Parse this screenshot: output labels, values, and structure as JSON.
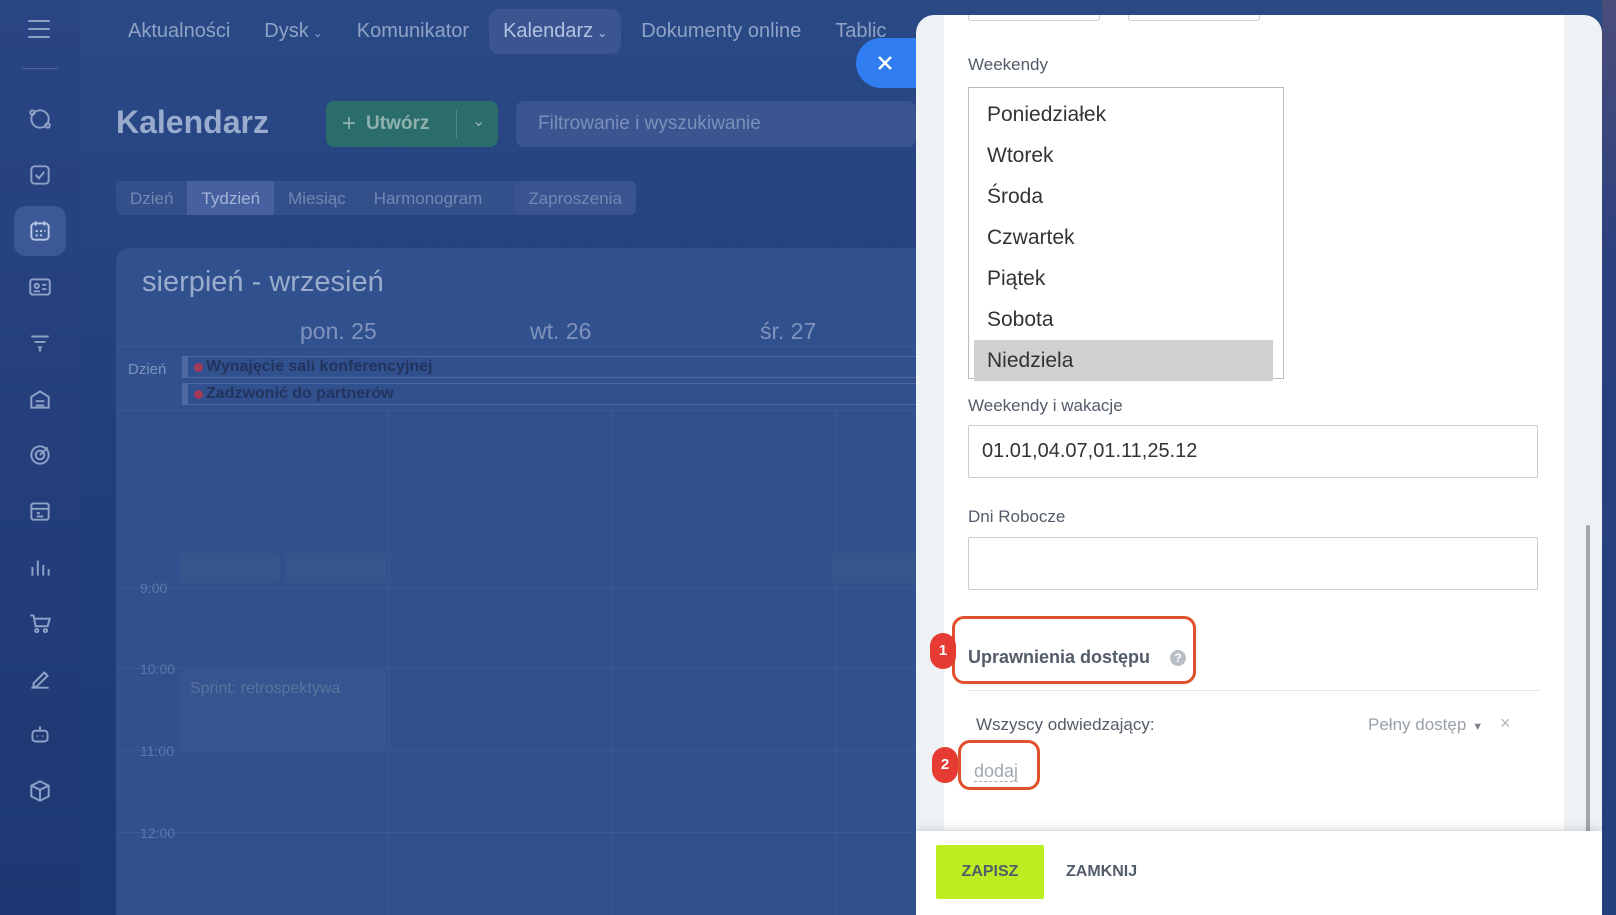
{
  "topnav": {
    "items": [
      {
        "label": "Aktualności",
        "has_menu": false,
        "active": false
      },
      {
        "label": "Dysk",
        "has_menu": true,
        "active": false
      },
      {
        "label": "Komunikator",
        "has_menu": false,
        "active": false
      },
      {
        "label": "Kalendarz",
        "has_menu": true,
        "active": true
      },
      {
        "label": "Dokumenty online",
        "has_menu": false,
        "active": false
      },
      {
        "label": "Tablic",
        "has_menu": false,
        "active": false
      }
    ]
  },
  "sidebar": {
    "icons": [
      "feed-icon",
      "tasks-icon",
      "calendar-icon",
      "contacts-icon",
      "filter-icon",
      "storage-icon",
      "target-icon",
      "schedule-icon",
      "chart-icon",
      "cart-icon",
      "sign-icon",
      "robot-icon",
      "cube-icon"
    ]
  },
  "page": {
    "title": "Kalendarz",
    "create_label": "Utwórz",
    "search_placeholder": "Filtrowanie i wyszukiwanie",
    "view_tabs": [
      "Dzień",
      "Tydzień",
      "Miesiąc",
      "Harmonogram"
    ],
    "invitations_tab": "Zaproszenia",
    "range_title": "sierpień - wrzesień",
    "day_headers": [
      "pon. 25",
      "wt. 26",
      "śr. 27"
    ],
    "allday_label": "Dzień",
    "allday_events": [
      "Wynajęcie sali konferencyjnej",
      "Zadzwonić do partnerów"
    ],
    "hours": [
      "9:00",
      "10:00",
      "11:00",
      "12:00"
    ],
    "sprint_event": "Sprint: retrospektywa"
  },
  "settings": {
    "weekends_label": "Weekendy",
    "weekdays": [
      "Poniedziałek",
      "Wtorek",
      "Środa",
      "Czwartek",
      "Piątek",
      "Sobota",
      "Niedziela"
    ],
    "weekend_selected": "Niedziela",
    "holidays_label": "Weekendy i wakacje",
    "holidays_value": "01.01,04.07,01.11,25.12",
    "workdays_label": "Dni Robocze",
    "workdays_value": "",
    "permissions_title": "Uprawnienia dostępu",
    "help_glyph": "?",
    "permission_row": {
      "who": "Wszyscy odwiedzający:",
      "level": "Pełny dostęp",
      "remove_glyph": "×"
    },
    "add_link": "dodaj",
    "callouts": [
      "1",
      "2"
    ]
  },
  "footer": {
    "save_label": "ZAPISZ",
    "close_label": "ZAMKNIJ"
  },
  "colors": {
    "save_button": "#bbed21",
    "close_panel_button": "#2f7df0",
    "callout": "#e53b33",
    "callout_border": "#e0502c"
  }
}
